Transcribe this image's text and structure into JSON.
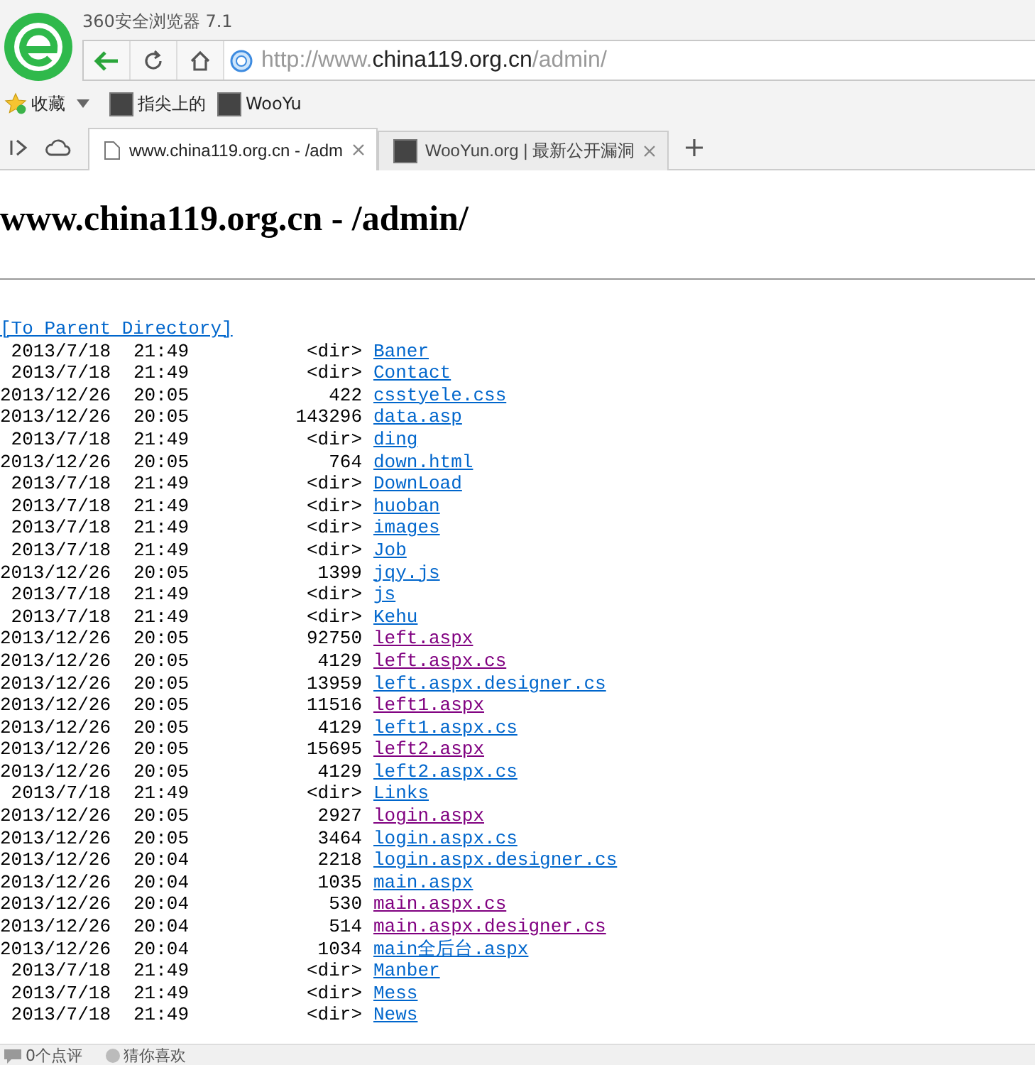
{
  "window": {
    "title": "360安全浏览器 7.1"
  },
  "address_bar": {
    "url_parts": [
      {
        "text": "http://www.",
        "highlighted": false
      },
      {
        "text": "china119.org.cn",
        "highlighted": true
      },
      {
        "text": "/admin/",
        "highlighted": false
      }
    ]
  },
  "bookmarks": [
    {
      "label": "收藏",
      "kind": "favorites"
    },
    {
      "label": "指尖上的",
      "kind": "site"
    },
    {
      "label": "WooYu",
      "kind": "site"
    }
  ],
  "tabs": [
    {
      "label": "www.china119.org.cn - /adm",
      "selected": true,
      "kind": "page"
    },
    {
      "label": "WooYun.org | 最新公开漏洞",
      "selected": false,
      "kind": "site"
    }
  ],
  "page": {
    "heading": "www.china119.org.cn - /admin/",
    "parent_link": "[To Parent Directory]",
    "rows": [
      {
        "date": "2013/7/18",
        "time": "21:49",
        "size": "<dir>",
        "name": "Baner",
        "visited": false
      },
      {
        "date": "2013/7/18",
        "time": "21:49",
        "size": "<dir>",
        "name": "Contact",
        "visited": false
      },
      {
        "date": "2013/12/26",
        "time": "20:05",
        "size": "422",
        "name": "csstyele.css",
        "visited": false
      },
      {
        "date": "2013/12/26",
        "time": "20:05",
        "size": "143296",
        "name": "data.asp",
        "visited": false
      },
      {
        "date": "2013/7/18",
        "time": "21:49",
        "size": "<dir>",
        "name": "ding",
        "visited": false
      },
      {
        "date": "2013/12/26",
        "time": "20:05",
        "size": "764",
        "name": "down.html",
        "visited": false
      },
      {
        "date": "2013/7/18",
        "time": "21:49",
        "size": "<dir>",
        "name": "DownLoad",
        "visited": false
      },
      {
        "date": "2013/7/18",
        "time": "21:49",
        "size": "<dir>",
        "name": "huoban",
        "visited": false
      },
      {
        "date": "2013/7/18",
        "time": "21:49",
        "size": "<dir>",
        "name": "images",
        "visited": false
      },
      {
        "date": "2013/7/18",
        "time": "21:49",
        "size": "<dir>",
        "name": "Job",
        "visited": false
      },
      {
        "date": "2013/12/26",
        "time": "20:05",
        "size": "1399",
        "name": "jqy.js",
        "visited": false
      },
      {
        "date": "2013/7/18",
        "time": "21:49",
        "size": "<dir>",
        "name": "js",
        "visited": false
      },
      {
        "date": "2013/7/18",
        "time": "21:49",
        "size": "<dir>",
        "name": "Kehu",
        "visited": false
      },
      {
        "date": "2013/12/26",
        "time": "20:05",
        "size": "92750",
        "name": "left.aspx",
        "visited": true
      },
      {
        "date": "2013/12/26",
        "time": "20:05",
        "size": "4129",
        "name": "left.aspx.cs",
        "visited": true
      },
      {
        "date": "2013/12/26",
        "time": "20:05",
        "size": "13959",
        "name": "left.aspx.designer.cs",
        "visited": false
      },
      {
        "date": "2013/12/26",
        "time": "20:05",
        "size": "11516",
        "name": "left1.aspx",
        "visited": true
      },
      {
        "date": "2013/12/26",
        "time": "20:05",
        "size": "4129",
        "name": "left1.aspx.cs",
        "visited": false
      },
      {
        "date": "2013/12/26",
        "time": "20:05",
        "size": "15695",
        "name": "left2.aspx",
        "visited": true
      },
      {
        "date": "2013/12/26",
        "time": "20:05",
        "size": "4129",
        "name": "left2.aspx.cs",
        "visited": false
      },
      {
        "date": "2013/7/18",
        "time": "21:49",
        "size": "<dir>",
        "name": "Links",
        "visited": false
      },
      {
        "date": "2013/12/26",
        "time": "20:05",
        "size": "2927",
        "name": "login.aspx",
        "visited": true
      },
      {
        "date": "2013/12/26",
        "time": "20:05",
        "size": "3464",
        "name": "login.aspx.cs",
        "visited": false
      },
      {
        "date": "2013/12/26",
        "time": "20:04",
        "size": "2218",
        "name": "login.aspx.designer.cs",
        "visited": false
      },
      {
        "date": "2013/12/26",
        "time": "20:04",
        "size": "1035",
        "name": "main.aspx",
        "visited": false
      },
      {
        "date": "2013/12/26",
        "time": "20:04",
        "size": "530",
        "name": "main.aspx.cs",
        "visited": true
      },
      {
        "date": "2013/12/26",
        "time": "20:04",
        "size": "514",
        "name": "main.aspx.designer.cs",
        "visited": true
      },
      {
        "date": "2013/12/26",
        "time": "20:04",
        "size": "1034",
        "name": "main全后台.aspx",
        "visited": false
      },
      {
        "date": "2013/7/18",
        "time": "21:49",
        "size": "<dir>",
        "name": "Manber",
        "visited": false
      },
      {
        "date": "2013/7/18",
        "time": "21:49",
        "size": "<dir>",
        "name": "Mess",
        "visited": false
      },
      {
        "date": "2013/7/18",
        "time": "21:49",
        "size": "<dir>",
        "name": "News",
        "visited": false
      }
    ]
  },
  "status_bar": [
    {
      "label": "0个点评",
      "kind": "comments"
    },
    {
      "label": "猜你喜欢",
      "kind": "recommend"
    }
  ]
}
